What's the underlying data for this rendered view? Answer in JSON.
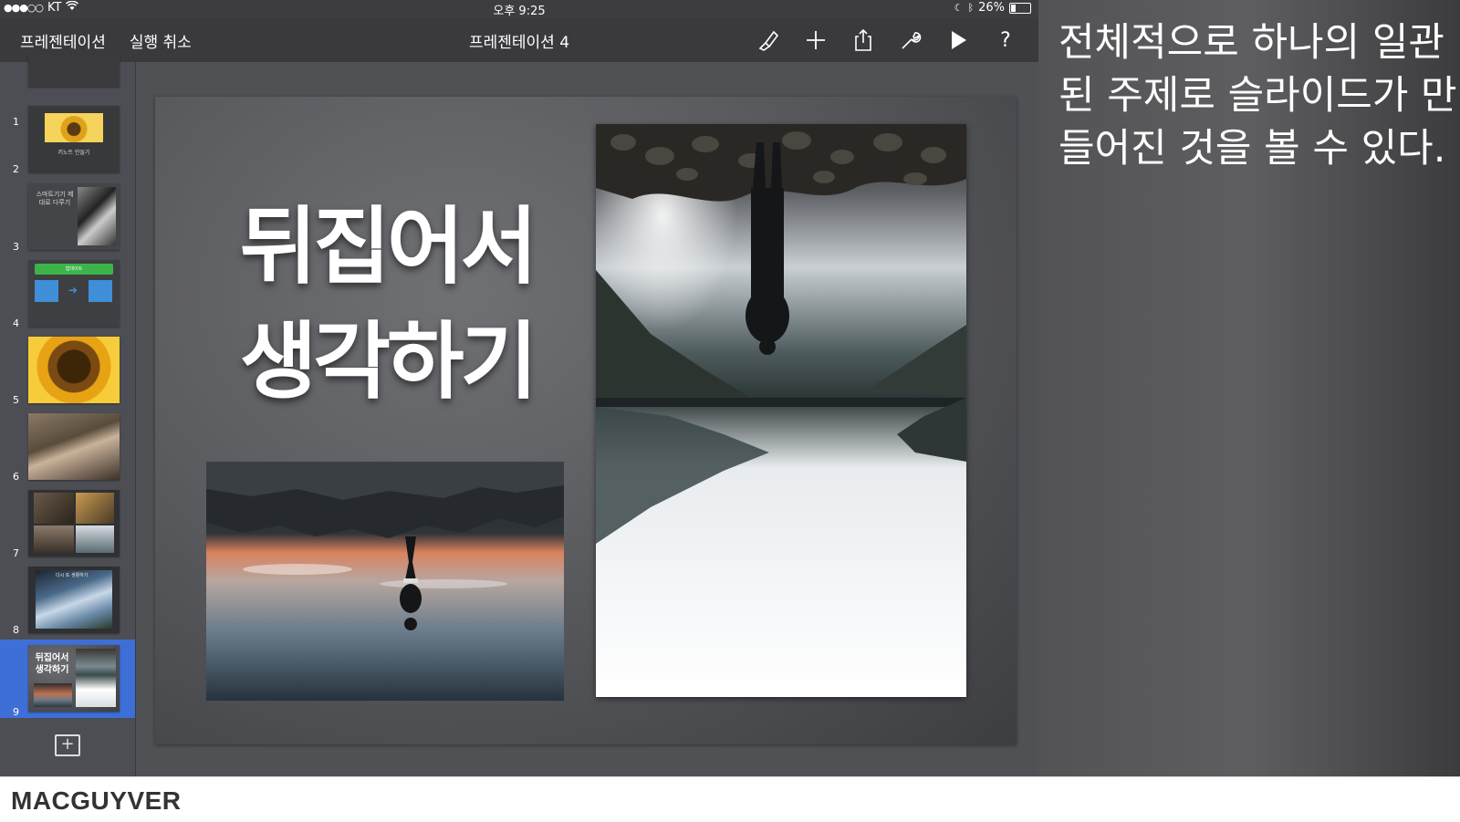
{
  "status": {
    "carrier": "KT",
    "time": "오후 9:25",
    "battery": "26%",
    "battery_level": 0.26
  },
  "toolbar": {
    "back_label": "프레젠테이션",
    "undo_label": "실행 취소",
    "title": "프레젠테이션 4",
    "icons": [
      "format-brush-icon",
      "add-icon",
      "share-icon",
      "wrench-icon",
      "play-icon",
      "help-icon"
    ]
  },
  "sidebar": {
    "slides": [
      {
        "number": "1",
        "text": ""
      },
      {
        "number": "2",
        "text": "키노트 만들기"
      },
      {
        "number": "3",
        "text": "스마트기기 제대로 다루기"
      },
      {
        "number": "4",
        "text": "업데이트"
      },
      {
        "number": "5",
        "text": ""
      },
      {
        "number": "6",
        "text": ""
      },
      {
        "number": "7",
        "text": ""
      },
      {
        "number": "8",
        "text": "다시 또 생활하기"
      },
      {
        "number": "9",
        "text": "뒤집어서 생각하기"
      }
    ],
    "selected_index": 8
  },
  "slide": {
    "title_line1": "뒤집어서",
    "title_line2": "생각하기"
  },
  "caption": "전체적으로 하나의 일관된 주제로 슬라이드가 만들어진 것을 볼 수 있다.",
  "footer": {
    "brand": "MACGUYVER"
  },
  "colors": {
    "selected": "#3d6fd6",
    "toolbar_bg": "#3a3a3d",
    "sidebar_bg": "#4d4e53"
  }
}
